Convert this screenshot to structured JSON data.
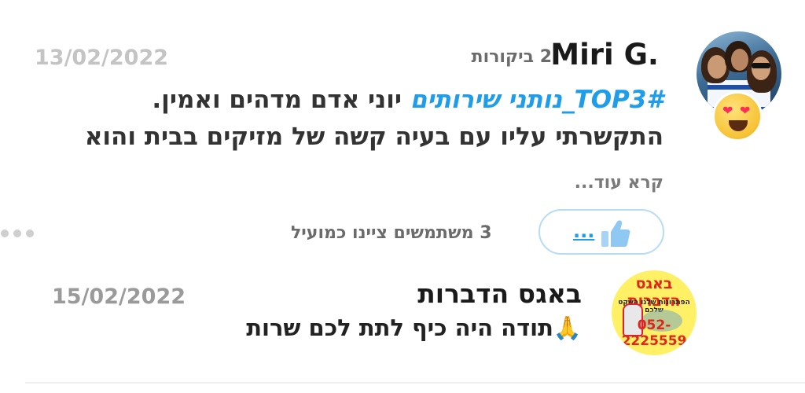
{
  "review": {
    "reviewer_name": "Miri G.",
    "reviews_count": "2 ביקורות",
    "date": "13/02/2022",
    "avatar_badge_emoji": "😍",
    "hashtag": "#TOP3_נותני שירותים",
    "line1_rest": "יוני אדם מדהים ואמין.",
    "line2": "התקשרתי עליו עם בעיה קשה של מזיקים בבית והוא",
    "read_more": "קרא עוד...",
    "like_button_label": "...",
    "helpful_text": "3 משתמשים ציינו כמועיל"
  },
  "reply": {
    "business_name": "באגס הדברות",
    "date": "15/02/2022",
    "text": "תודה היה כיף לתת לכם שרות",
    "emoji": "🙏",
    "logo": {
      "title": "באגס הדברות",
      "tagline": "הפתרונות שלנו השקט שלכם",
      "phone": "052-2225559"
    }
  },
  "colors": {
    "accent": "#1e9dea",
    "pill_border": "#b6dcf6",
    "muted": "#6b6b6b",
    "date": "#c4c4c4",
    "logo_background": "#fff066",
    "logo_red": "#e0261c"
  },
  "icons": [
    "reviewer-avatar",
    "heart-eyes-emoji-icon",
    "thumbs-up-icon",
    "more-options-icon",
    "business-logo",
    "praying-hands-emoji-icon"
  ]
}
